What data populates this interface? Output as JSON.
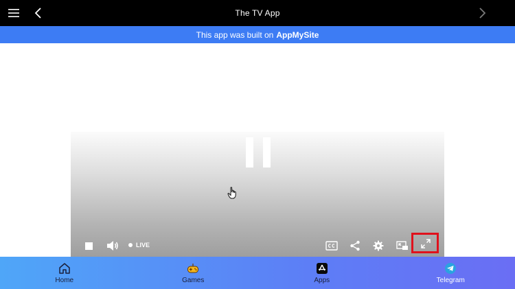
{
  "header": {
    "title": "The TV App"
  },
  "banner": {
    "text": "This app was built on",
    "brand": "AppMySite"
  },
  "player": {
    "live_label": "LIVE"
  },
  "bottom_nav": {
    "items": [
      {
        "label": "Home",
        "icon": "home-icon"
      },
      {
        "label": "Games",
        "icon": "gamepad-icon"
      },
      {
        "label": "Apps",
        "icon": "app-store-icon"
      },
      {
        "label": "Telegram",
        "icon": "telegram-icon"
      }
    ]
  },
  "colors": {
    "topbar": "#000000",
    "banner": "#3d7cf4",
    "highlight": "#e0111c"
  }
}
